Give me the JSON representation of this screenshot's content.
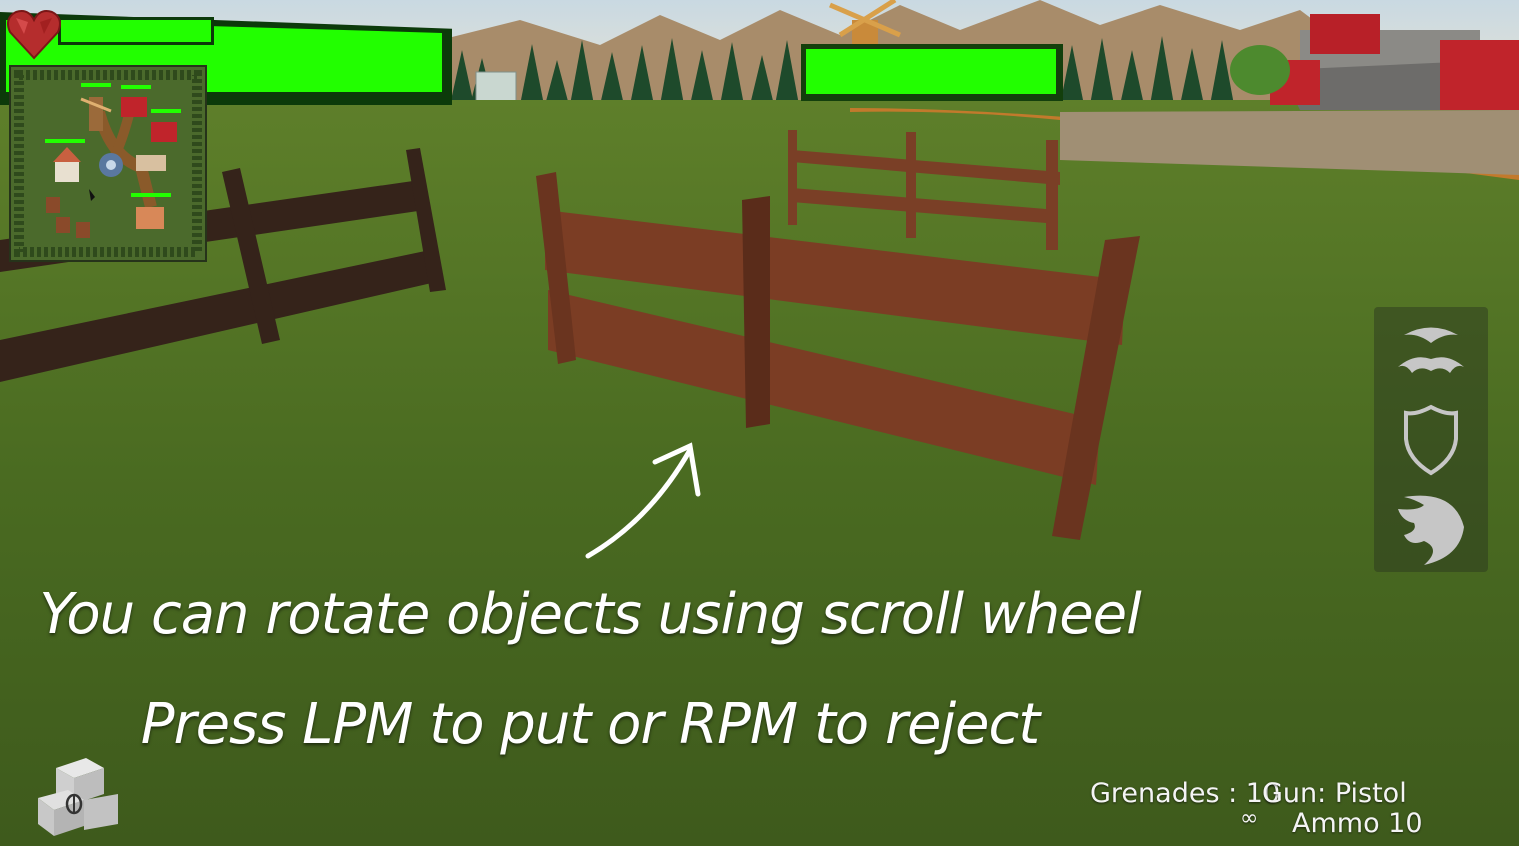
{
  "scene": {
    "sky_color": "#d9e4ea",
    "grass_color": "#4f6f25",
    "fence_color": "#7a3f26",
    "fence_dark": "#3a2418",
    "tree_color": "#1f4d2c"
  },
  "hud": {
    "player_health_fraction": 1.0,
    "enemy_health_fraction": 1.0,
    "health_color": "#22ff00",
    "heart_icon": "heart-icon"
  },
  "minimap": {
    "icons": [
      "windmill-icon",
      "barn-icon",
      "house-icon",
      "fountain-icon",
      "market-icon",
      "shed-icon",
      "cursor-icon"
    ]
  },
  "abilities": [
    {
      "name": "wings-ability-icon"
    },
    {
      "name": "shield-ability-icon"
    },
    {
      "name": "dash-ability-icon"
    }
  ],
  "tutorial": {
    "line1": "You can rotate objects using scroll wheel",
    "line2": "Press LPM to put or RPM to reject"
  },
  "stats": {
    "grenades_label": "Grenades : 10",
    "gun_label": "Gun: Pistol",
    "infinity": "∞",
    "ammo_label": "Ammo 10"
  },
  "build": {
    "icon": "build-blocks-icon"
  }
}
